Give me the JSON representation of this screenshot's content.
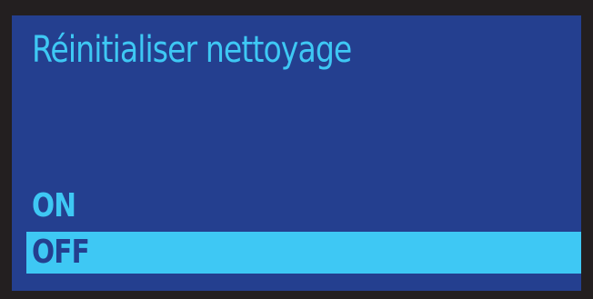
{
  "screen": {
    "title": "Réinitialiser nettoyage",
    "options": [
      {
        "label": "ON",
        "selected": false
      },
      {
        "label": "OFF",
        "selected": true
      }
    ]
  },
  "colors": {
    "bezel": "#231f20",
    "background": "#243f8f",
    "accent": "#3ec8f4"
  }
}
